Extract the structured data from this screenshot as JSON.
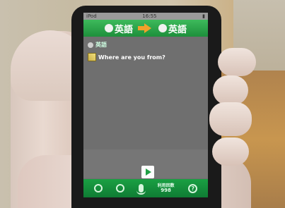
{
  "status_bar": {
    "carrier": "iPod",
    "time": "16:55"
  },
  "header": {
    "source_language": "英語",
    "target_language": "英語"
  },
  "content": {
    "source_label": "英語",
    "question_text": "Where are you from?"
  },
  "toolbar": {
    "counter_label": "利用回数",
    "counter_value": "998"
  }
}
